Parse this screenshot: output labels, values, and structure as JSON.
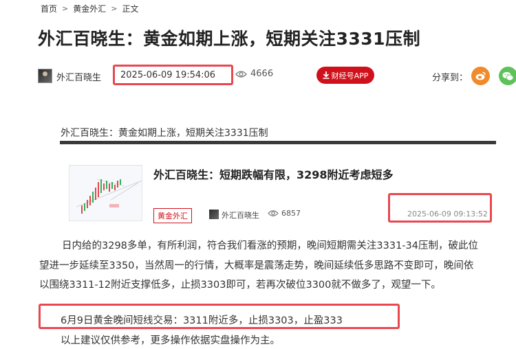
{
  "breadcrumb": {
    "items": [
      "首页",
      "黄金外汇",
      "正文"
    ],
    "separator": ">"
  },
  "article": {
    "title": "外汇百晓生：黄金如期上涨，短期关注3331压制",
    "author": "外汇百晓生",
    "published": "2025-06-09 19:54:06",
    "views": "4666",
    "app_button": "财经号APP",
    "share_label": "分享到："
  },
  "embedded": {
    "heading": "外汇百晓生：黄金如期上涨，短期关注3331压制",
    "card": {
      "title": "外汇百晓生：短期跌幅有限，3298附近考虑短多",
      "tag": "黄金外汇",
      "author": "外汇百晓生",
      "views": "6857",
      "time": "2025-06-09 09:13:52"
    }
  },
  "body": {
    "line1": "日内给的3298多单，有所利润，符合我们看涨的预期，晚间短期需关注3331-34压制，破此位",
    "line2": "望进一步延续至3350，当然周一的行情，大概率是震荡走势，晚间延续低多思路不变即可，晚间依",
    "line3": "以围绕3311-12附近支撑低多，止损3303即可，若再次破位3300就不做多了，观望一下。",
    "trade": "6月9日黄金晚间短线交易：3311附近多，止损3303，止盈333",
    "disclaimer": "以上建议仅供参考，更多操作依据实盘操作为主。"
  },
  "colors": {
    "accent_red": "#d0111b",
    "highlight_box": "#e8474f",
    "weibo": "#f08a2a",
    "wechat": "#5ec25a"
  },
  "icons": [
    "eye-icon",
    "download-icon",
    "weibo-icon",
    "wechat-icon"
  ]
}
